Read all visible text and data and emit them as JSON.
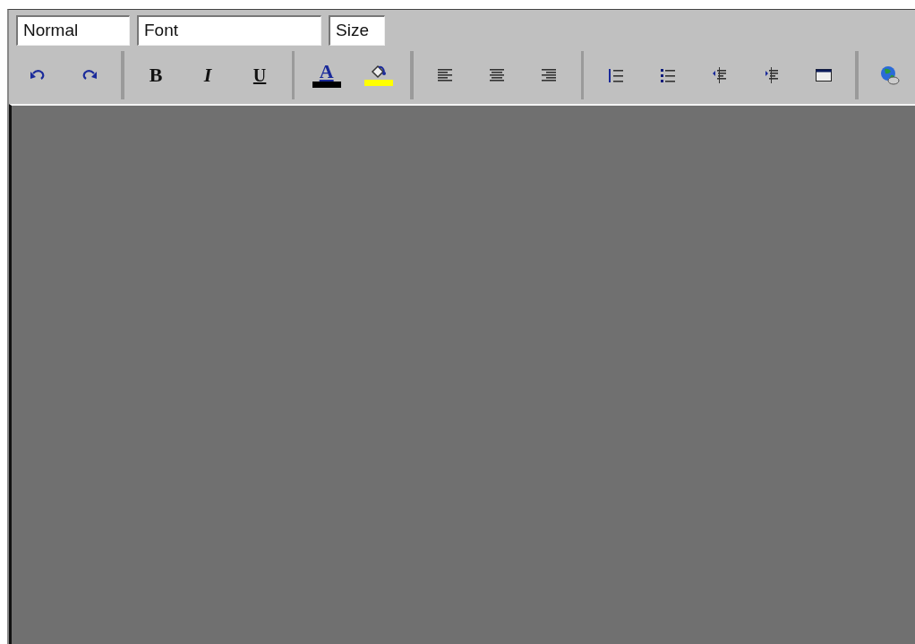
{
  "toolbar": {
    "fields": [
      {
        "kind": "format",
        "value": "Normal"
      },
      {
        "kind": "font",
        "value": "Font"
      },
      {
        "kind": "size",
        "value": "Size"
      }
    ],
    "groups": [
      [
        {
          "kind": "undo"
        },
        {
          "kind": "redo"
        }
      ],
      [
        {
          "kind": "bold",
          "label": "B"
        },
        {
          "kind": "italic",
          "label": "I"
        },
        {
          "kind": "underline",
          "label": "U"
        }
      ],
      [
        {
          "kind": "text-color",
          "label": "A",
          "color": "#000000"
        },
        {
          "kind": "highlight",
          "color": "#ffff00"
        }
      ],
      [
        {
          "kind": "align-left"
        },
        {
          "kind": "align-center"
        },
        {
          "kind": "align-right"
        }
      ],
      [
        {
          "kind": "ordered-list"
        },
        {
          "kind": "bullet-list"
        },
        {
          "kind": "outdent"
        },
        {
          "kind": "indent"
        },
        {
          "kind": "table"
        }
      ],
      [
        {
          "kind": "link"
        }
      ]
    ]
  }
}
